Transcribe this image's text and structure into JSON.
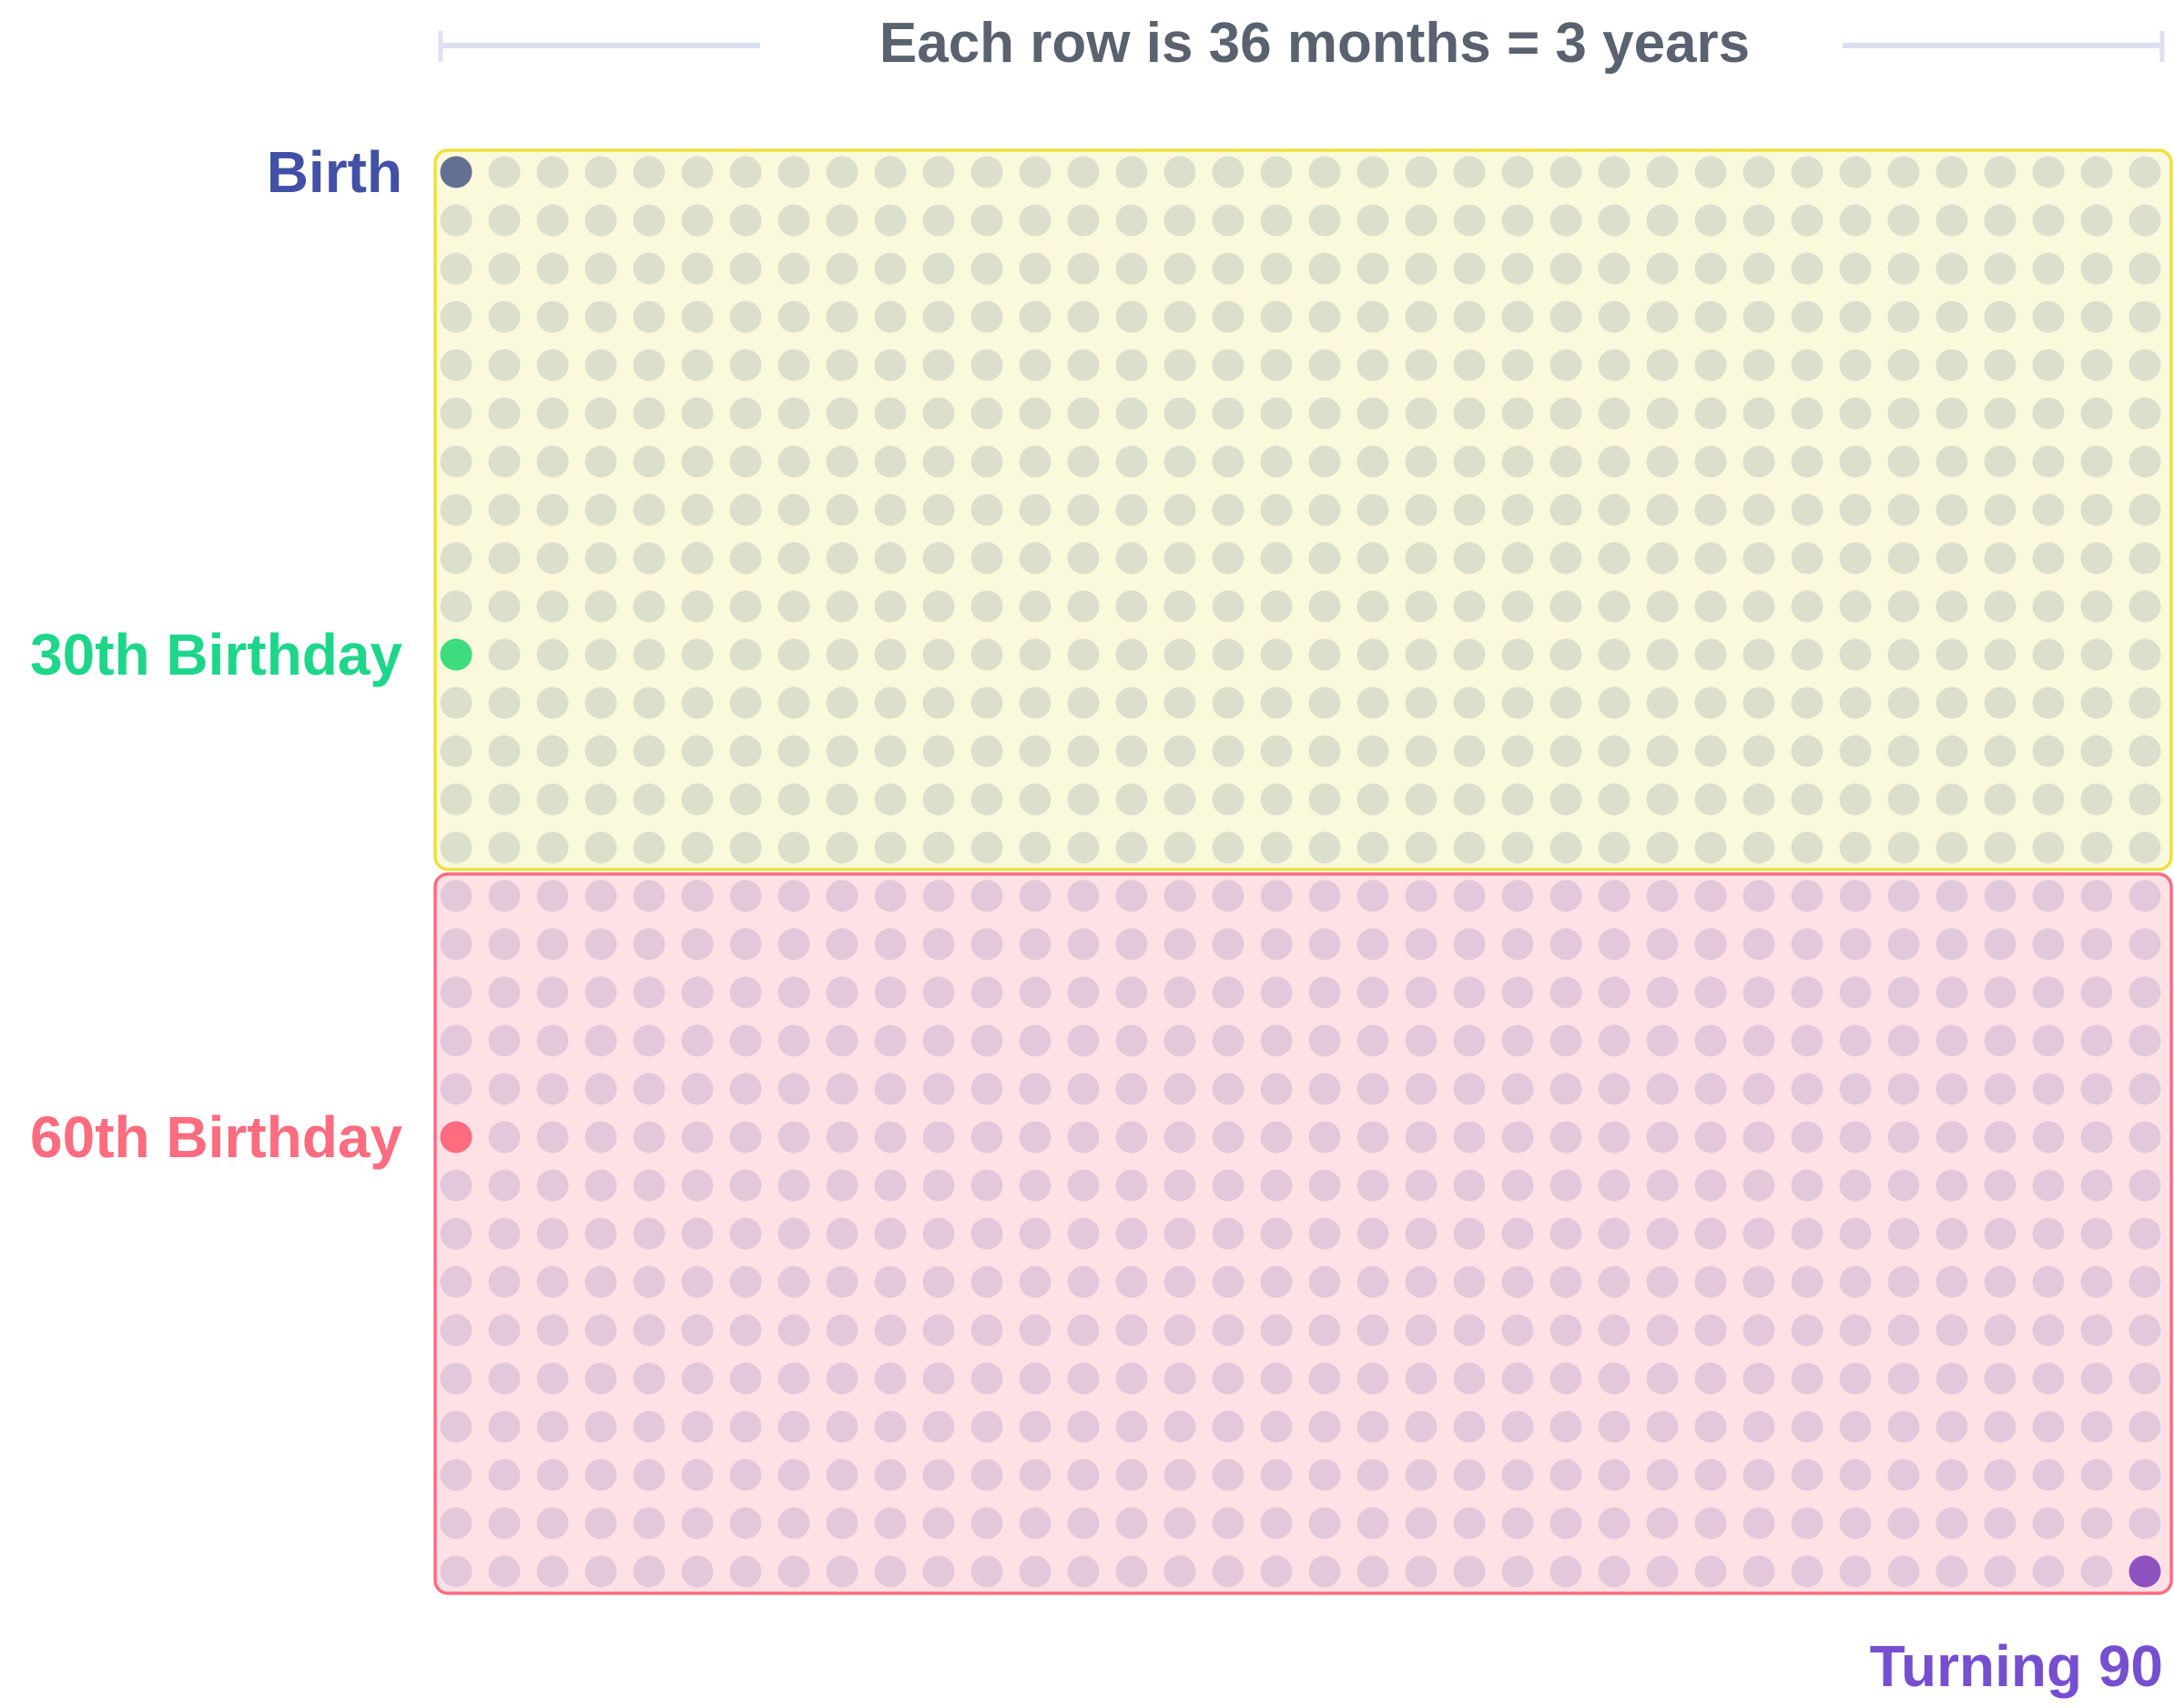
{
  "chart_data": {
    "type": "waffle",
    "title": "Each row is 36 months = 3 years",
    "columns": 36,
    "rows": 30,
    "unit": "month",
    "sections": [
      {
        "rows_from": 1,
        "rows_to": 15,
        "fill": "#fbf9dc",
        "border": "#eee040",
        "dot_color": "#dcdfcc"
      },
      {
        "rows_from": 16,
        "rows_to": 30,
        "fill": "#ffe1e5",
        "border": "#ff6b80",
        "dot_color": "#e2c8da"
      }
    ],
    "milestones": [
      {
        "label": "Birth",
        "month": 0,
        "label_color": "#4350a8",
        "dot_color": "#647093",
        "label_side": "left"
      },
      {
        "label": "30th Birthday",
        "month": 360,
        "label_color": "#1ed68a",
        "dot_color": "#3ddc7e",
        "label_side": "left"
      },
      {
        "label": "60th Birthday",
        "month": 720,
        "label_color": "#ff6b7f",
        "dot_color": "#ff6b7f",
        "label_side": "left"
      },
      {
        "label": "Turning 90",
        "month": 1079,
        "label_color": "#764fd0",
        "dot_color": "#8e52bf",
        "label_side": "below-right"
      }
    ],
    "title_color": "#5a6270",
    "bracket_color": "#dce0f2"
  }
}
